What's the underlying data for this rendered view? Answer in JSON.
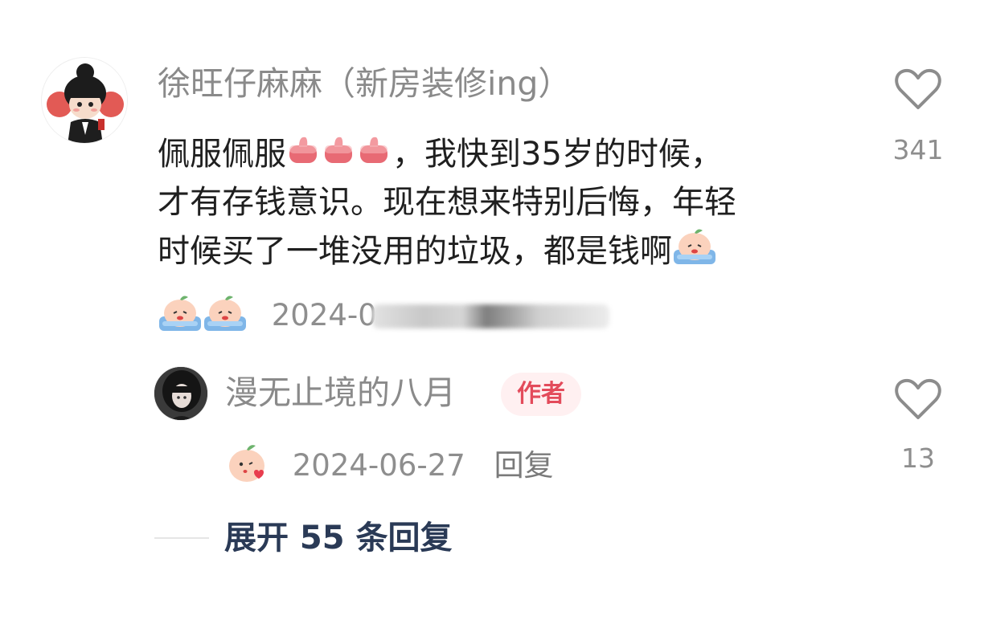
{
  "comment": {
    "username": "徐旺仔麻麻（新房装修ing）",
    "text_line1_a": "佩服佩服",
    "text_line1_b": "，我快到35岁的时候，",
    "text_line2": "才有存钱意识。现在想来特别后悔，年轻",
    "text_line3": "时候买了一堆没用的垃圾，都是钱啊",
    "date_visible": "2024-0",
    "like_count": "341",
    "emojis": [
      "thumbs-up-icon",
      "thumbs-up-icon",
      "thumbs-up-icon",
      "crying-peach-icon",
      "crying-peach-icon",
      "crying-peach-icon"
    ]
  },
  "reply": {
    "username": "漫无止境的八月",
    "author_badge": "作者",
    "date": "2024-06-27",
    "reply_label": "回复",
    "like_count": "13",
    "emoji": "kiss-heart-peach-icon"
  },
  "expand_label": "展开 55 条回复",
  "colors": {
    "badge_bg": "#fff0f1",
    "badge_text": "#e34b5b",
    "expand_text": "#2a3a56",
    "meta_text": "#8e8e8e"
  }
}
